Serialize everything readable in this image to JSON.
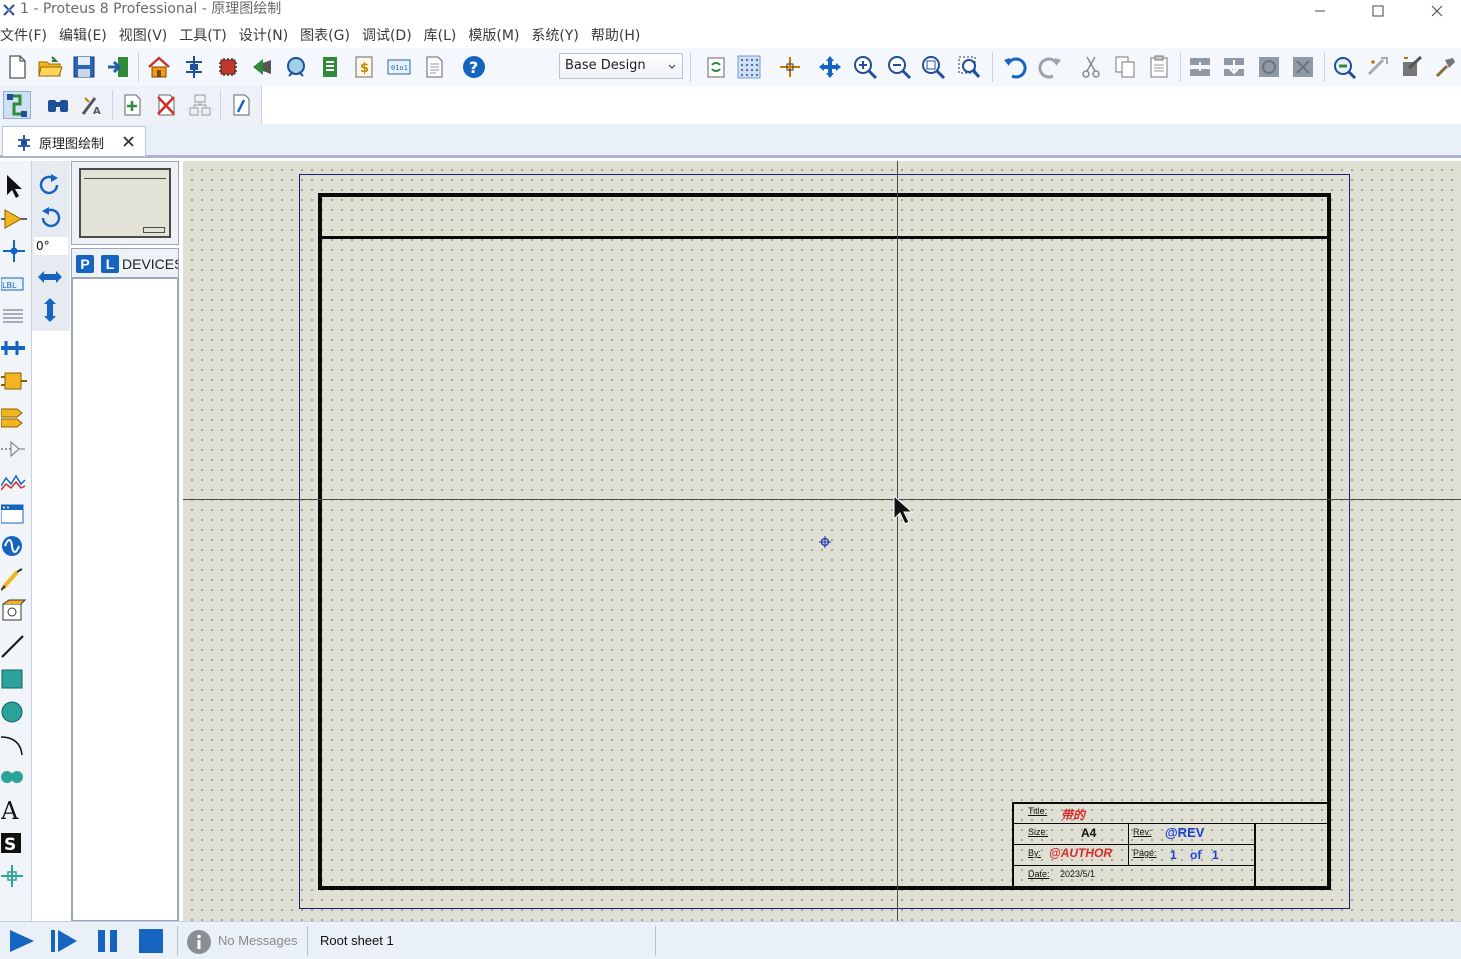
{
  "window": {
    "title": "1 - Proteus 8 Professional - 原理图绘制",
    "controls": [
      "minimize-icon",
      "maximize-icon",
      "close-icon"
    ]
  },
  "menu": [
    {
      "label": "文件(F)"
    },
    {
      "label": "编辑(E)"
    },
    {
      "label": "视图(V)"
    },
    {
      "label": "工具(T)"
    },
    {
      "label": "设计(N)"
    },
    {
      "label": "图表(G)"
    },
    {
      "label": "调试(D)"
    },
    {
      "label": "库(L)"
    },
    {
      "label": "模版(M)"
    },
    {
      "label": "系统(Y)"
    },
    {
      "label": "帮助(H)"
    }
  ],
  "toolbar": {
    "design_variant": "Base Design",
    "icons_row1": [
      "new-file-icon",
      "open-folder-icon",
      "save-icon",
      "import-icon",
      "home-icon",
      "schematic-icon",
      "pcb-icon",
      "3d-view-icon",
      "gerber-icon",
      "bom-icon",
      "cost-icon",
      "source-code-icon",
      "notes-icon",
      "help-icon",
      "refresh-icon",
      "grid-icon",
      "origin-icon",
      "pan-icon",
      "zoom-in-icon",
      "zoom-out-icon",
      "zoom-all-icon",
      "zoom-area-icon",
      "undo-icon",
      "redo-icon",
      "cut-icon",
      "copy-icon",
      "paste-icon",
      "block-copy-icon",
      "block-move-icon",
      "block-rotate-icon",
      "block-delete-icon",
      "pick-device-icon",
      "make-device-icon",
      "packaging-icon",
      "decompose-icon"
    ],
    "icons_row2": [
      "wire-autorouter-icon",
      "search-tag-icon",
      "property-assign-icon",
      "new-sheet-icon",
      "delete-sheet-icon",
      "goto-sheet-icon",
      "netlist-icon"
    ]
  },
  "tab": {
    "label": "原理图绘制",
    "icon": "schematic-tab-icon"
  },
  "mode_tools": [
    "selection-mode-icon",
    "component-mode-icon",
    "junction-dot-icon",
    "wire-label-icon",
    "text-script-icon",
    "buses-icon",
    "subcircuit-icon",
    "terminals-icon",
    "device-pins-icon",
    "graph-icon",
    "tape-recorder-icon",
    "generator-icon",
    "voltage-probe-icon",
    "virtual-instrument-icon",
    "2d-line-icon",
    "2d-box-icon",
    "2d-circle-icon",
    "2d-arc-icon",
    "2d-path-icon",
    "2d-text-icon",
    "2d-symbol-icon",
    "2d-marker-icon"
  ],
  "rotation": {
    "angle": "0°",
    "icons": [
      "rotate-clockwise-icon",
      "rotate-anticlockwise-icon",
      "mirror-horizontal-icon",
      "mirror-vertical-icon"
    ]
  },
  "device_panel": {
    "p_button": "P",
    "l_button": "L",
    "label": "DEVICES"
  },
  "title_block": {
    "title_label": "Title:",
    "title_value": "带的",
    "size_label": "Size:",
    "size_value": "A4",
    "rev_label": "Rev:",
    "rev_value": "@REV",
    "by_label": "By:",
    "by_value": "@AUTHOR",
    "page_label": "Page:",
    "page_num": "1",
    "page_of": "of",
    "page_total": "1",
    "date_label": "Date:",
    "date_value": "2023/5/1"
  },
  "status": {
    "messages": "No Messages",
    "sheet": "Root sheet 1",
    "sim_controls": [
      "play-icon",
      "step-icon",
      "pause-icon",
      "stop-icon"
    ]
  },
  "colors": {
    "canvas": "#e0dfd3",
    "sheet_frame": "#1d1f7a",
    "accent_blue": "#1565c0",
    "title_red": "#d52b2b"
  }
}
